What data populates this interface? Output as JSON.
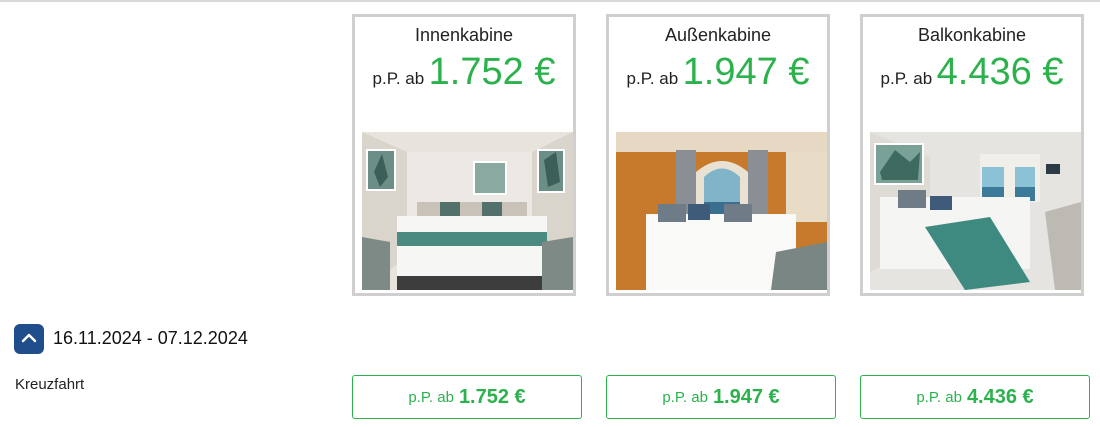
{
  "cabins": [
    {
      "name": "Innenkabine",
      "price_prefix": "p.P. ab",
      "price": "1.752 €",
      "image": "interior-cabin-photo"
    },
    {
      "name": "Außenkabine",
      "price_prefix": "p.P. ab",
      "price": "1.947 €",
      "image": "oceanview-cabin-photo"
    },
    {
      "name": "Balkonkabine",
      "price_prefix": "p.P. ab",
      "price": "4.436 €",
      "image": "balcony-cabin-photo"
    }
  ],
  "date_row": {
    "toggle_icon": "chevron-up-icon",
    "range": "16.11.2024 - 07.12.2024"
  },
  "offer_row": {
    "label": "Kreuzfahrt",
    "buttons": [
      {
        "prefix": "p.P. ab",
        "price": "1.752 €"
      },
      {
        "prefix": "p.P. ab",
        "price": "1.947 €"
      },
      {
        "prefix": "p.P. ab",
        "price": "4.436 €"
      }
    ]
  },
  "colors": {
    "price_green": "#2bb24c",
    "toggle_blue": "#1f4e8a",
    "card_border": "#cfcfcf"
  }
}
